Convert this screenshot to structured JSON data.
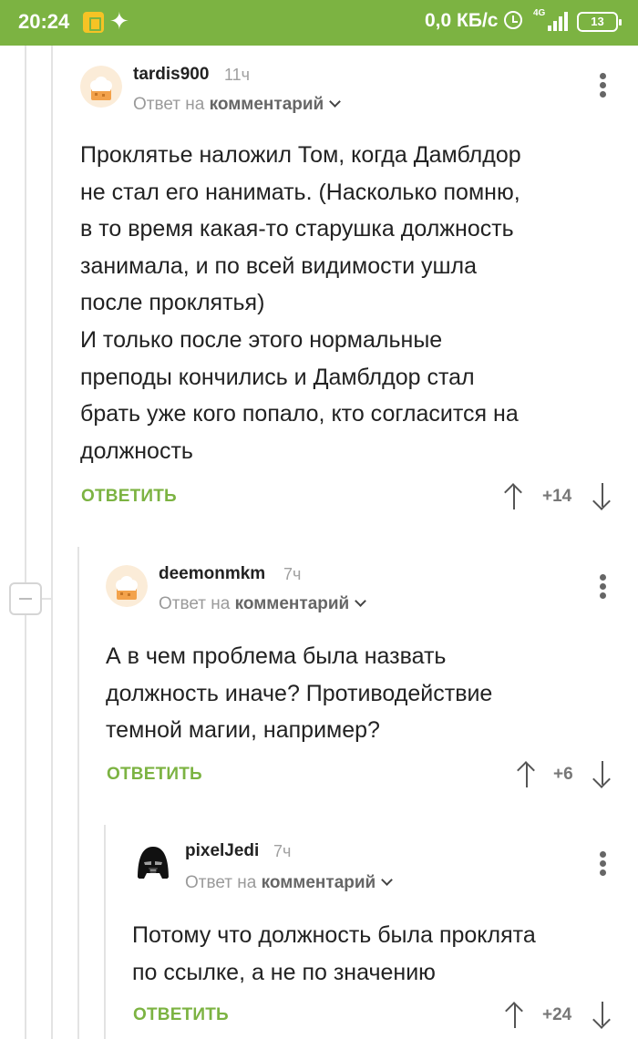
{
  "status_bar": {
    "time": "20:24",
    "speed": "0,0 КБ/с",
    "network": "4G",
    "battery": "13"
  },
  "comments": [
    {
      "author": "tardis900",
      "age": "11ч",
      "reply_prefix": "Ответ на",
      "reply_target": "комментарий",
      "text": "Проклятье наложил Том, когда Дамблдор\nне стал его нанимать. (Насколько помню,\nв то время какая-то старушка должность\nзанимала, и по всей видимости ушла\nпосле проклятья)\nИ только после этого нормальные\nпреподы кончились и Дамблдор стал\nбрать уже кого попало, кто согласится на\nдолжность",
      "reply_label": "ОТВЕТИТЬ",
      "score": "+14",
      "avatar_icon": "chef-hat-avatar-icon"
    },
    {
      "author": "deemonmkm",
      "age": "7ч",
      "reply_prefix": "Ответ на",
      "reply_target": "комментарий",
      "text": "А в чем проблема была назвать\nдолжность иначе? Противодействие\nтемной магии, например?",
      "reply_label": "ОТВЕТИТЬ",
      "score": "+6",
      "avatar_icon": "chef-hat-avatar-icon"
    },
    {
      "author": "pixelJedi",
      "age": "7ч",
      "reply_prefix": "Ответ на",
      "reply_target": "комментарий",
      "text": "Потому что должность была проклята\nпо ссылке, а не по значению",
      "reply_label": "ОТВЕТИТЬ",
      "score": "+24",
      "avatar_icon": "darth-vader-avatar-icon"
    }
  ],
  "colors": {
    "brand_green": "#7cb342",
    "thread_line": "#e3e3e3"
  }
}
